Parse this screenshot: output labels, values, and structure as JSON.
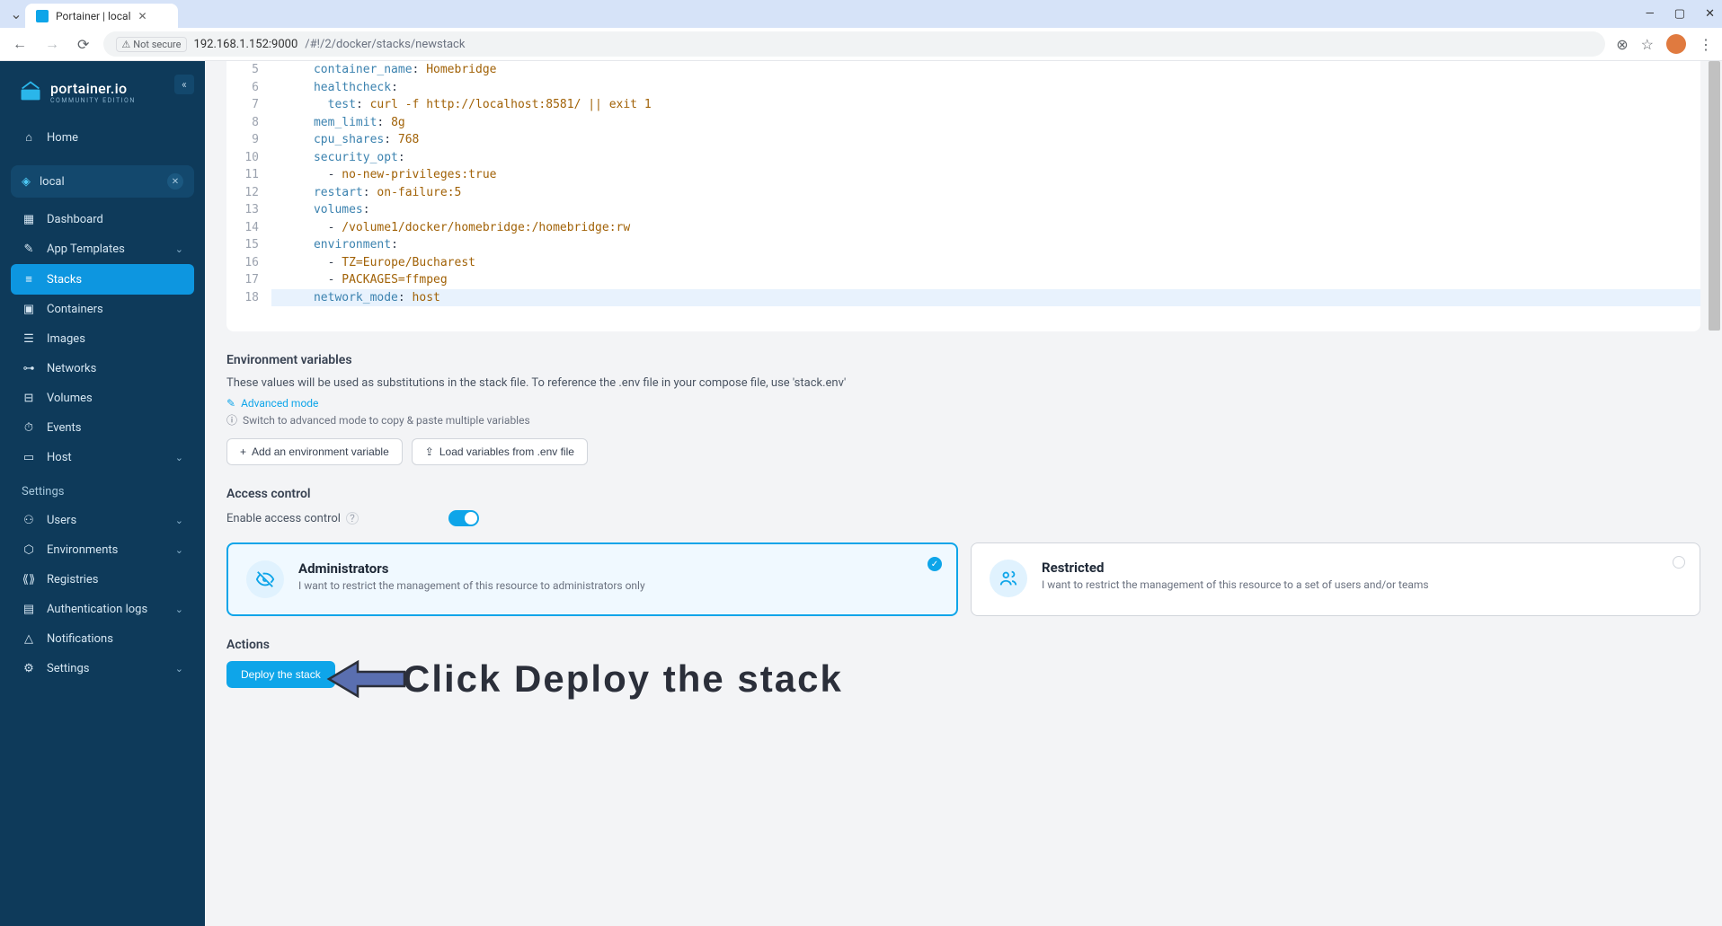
{
  "browser": {
    "tab_title": "Portainer | local",
    "url_display_prefix": "192.168.1.152:9000",
    "url_display_path": "/#!/2/docker/stacks/newstack",
    "not_secure": "Not secure"
  },
  "logo": {
    "main": "portainer.io",
    "sub": "COMMUNITY EDITION"
  },
  "sidebar": {
    "home": "Home",
    "env_label": "local",
    "items": [
      {
        "label": "Dashboard"
      },
      {
        "label": "App Templates",
        "expandable": true
      },
      {
        "label": "Stacks",
        "active": true
      },
      {
        "label": "Containers"
      },
      {
        "label": "Images"
      },
      {
        "label": "Networks"
      },
      {
        "label": "Volumes"
      },
      {
        "label": "Events"
      },
      {
        "label": "Host",
        "expandable": true
      }
    ],
    "settings_heading": "Settings",
    "settings": [
      {
        "label": "Users",
        "expandable": true
      },
      {
        "label": "Environments",
        "expandable": true
      },
      {
        "label": "Registries"
      },
      {
        "label": "Authentication logs",
        "expandable": true
      },
      {
        "label": "Notifications"
      },
      {
        "label": "Settings",
        "expandable": true
      }
    ]
  },
  "editor": {
    "lines": [
      {
        "n": 5,
        "indent": 3,
        "key": "container_name",
        "val": "Homebridge"
      },
      {
        "n": 6,
        "indent": 3,
        "key": "healthcheck",
        "val": ""
      },
      {
        "n": 7,
        "indent": 4,
        "key": "test",
        "val": "curl -f http://localhost:8581/ || exit 1"
      },
      {
        "n": 8,
        "indent": 3,
        "key": "mem_limit",
        "val": "8g"
      },
      {
        "n": 9,
        "indent": 3,
        "key": "cpu_shares",
        "val": "768"
      },
      {
        "n": 10,
        "indent": 3,
        "key": "security_opt",
        "val": ""
      },
      {
        "n": 11,
        "indent": 4,
        "list": true,
        "val": "no-new-privileges:true"
      },
      {
        "n": 12,
        "indent": 3,
        "key": "restart",
        "val": "on-failure:5"
      },
      {
        "n": 13,
        "indent": 3,
        "key": "volumes",
        "val": ""
      },
      {
        "n": 14,
        "indent": 4,
        "list": true,
        "val": "/volume1/docker/homebridge:/homebridge:rw"
      },
      {
        "n": 15,
        "indent": 3,
        "key": "environment",
        "val": ""
      },
      {
        "n": 16,
        "indent": 4,
        "list": true,
        "val": "TZ=Europe/Bucharest"
      },
      {
        "n": 17,
        "indent": 4,
        "list": true,
        "val": "PACKAGES=ffmpeg"
      },
      {
        "n": 18,
        "indent": 3,
        "key": "network_mode",
        "val": "host",
        "hl": true
      }
    ]
  },
  "env_vars": {
    "title": "Environment variables",
    "desc": "These values will be used as substitutions in the stack file. To reference the .env file in your compose file, use 'stack.env'",
    "advanced": "Advanced mode",
    "hint": "Switch to advanced mode to copy & paste multiple variables",
    "add_btn": "Add an environment variable",
    "load_btn": "Load variables from .env file"
  },
  "access": {
    "title": "Access control",
    "enable_label": "Enable access control",
    "cards": {
      "admin": {
        "title": "Administrators",
        "desc": "I want to restrict the management of this resource to administrators only"
      },
      "restricted": {
        "title": "Restricted",
        "desc": "I want to restrict the management of this resource to a set of users and/or teams"
      }
    }
  },
  "actions": {
    "title": "Actions",
    "deploy": "Deploy the stack"
  },
  "annotation": "Click Deploy the stack"
}
